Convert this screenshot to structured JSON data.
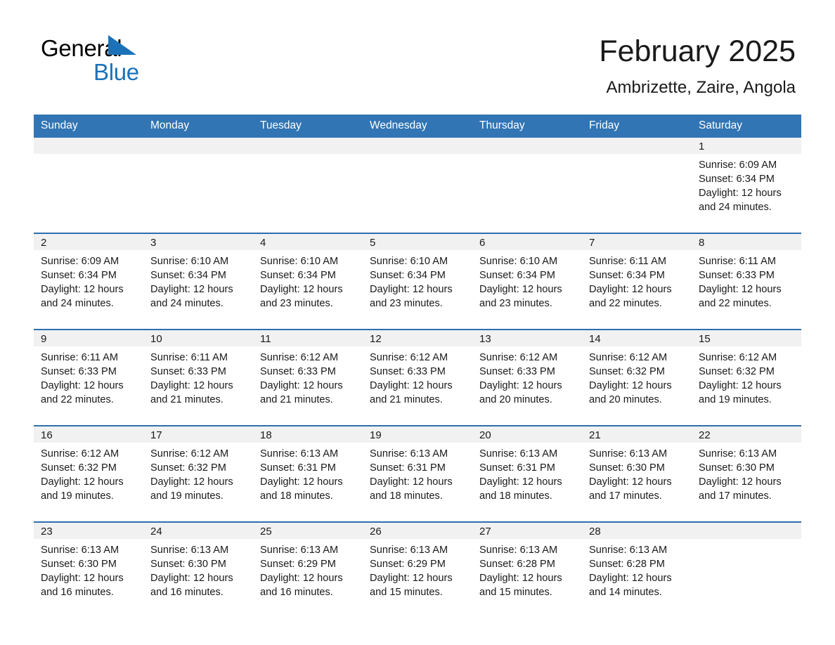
{
  "brand": {
    "word1": "General",
    "word2": "Blue",
    "triangle_color": "#1b72b8",
    "text_color": "#000000"
  },
  "header": {
    "title": "February 2025",
    "subtitle": "Ambrizette, Zaire, Angola"
  },
  "theme": {
    "header_blue": "#3175b4",
    "row_divider_blue": "#2e6fae",
    "daynum_band": "#f1f1f1",
    "page_background": "#ffffff"
  },
  "weekday_headers": [
    "Sunday",
    "Monday",
    "Tuesday",
    "Wednesday",
    "Thursday",
    "Friday",
    "Saturday"
  ],
  "weeks": [
    [
      {
        "day": "",
        "sunrise": "",
        "sunset": "",
        "daylight1": "",
        "daylight2": ""
      },
      {
        "day": "",
        "sunrise": "",
        "sunset": "",
        "daylight1": "",
        "daylight2": ""
      },
      {
        "day": "",
        "sunrise": "",
        "sunset": "",
        "daylight1": "",
        "daylight2": ""
      },
      {
        "day": "",
        "sunrise": "",
        "sunset": "",
        "daylight1": "",
        "daylight2": ""
      },
      {
        "day": "",
        "sunrise": "",
        "sunset": "",
        "daylight1": "",
        "daylight2": ""
      },
      {
        "day": "",
        "sunrise": "",
        "sunset": "",
        "daylight1": "",
        "daylight2": ""
      },
      {
        "day": "1",
        "sunrise": "Sunrise: 6:09 AM",
        "sunset": "Sunset: 6:34 PM",
        "daylight1": "Daylight: 12 hours",
        "daylight2": "and 24 minutes."
      }
    ],
    [
      {
        "day": "2",
        "sunrise": "Sunrise: 6:09 AM",
        "sunset": "Sunset: 6:34 PM",
        "daylight1": "Daylight: 12 hours",
        "daylight2": "and 24 minutes."
      },
      {
        "day": "3",
        "sunrise": "Sunrise: 6:10 AM",
        "sunset": "Sunset: 6:34 PM",
        "daylight1": "Daylight: 12 hours",
        "daylight2": "and 24 minutes."
      },
      {
        "day": "4",
        "sunrise": "Sunrise: 6:10 AM",
        "sunset": "Sunset: 6:34 PM",
        "daylight1": "Daylight: 12 hours",
        "daylight2": "and 23 minutes."
      },
      {
        "day": "5",
        "sunrise": "Sunrise: 6:10 AM",
        "sunset": "Sunset: 6:34 PM",
        "daylight1": "Daylight: 12 hours",
        "daylight2": "and 23 minutes."
      },
      {
        "day": "6",
        "sunrise": "Sunrise: 6:10 AM",
        "sunset": "Sunset: 6:34 PM",
        "daylight1": "Daylight: 12 hours",
        "daylight2": "and 23 minutes."
      },
      {
        "day": "7",
        "sunrise": "Sunrise: 6:11 AM",
        "sunset": "Sunset: 6:34 PM",
        "daylight1": "Daylight: 12 hours",
        "daylight2": "and 22 minutes."
      },
      {
        "day": "8",
        "sunrise": "Sunrise: 6:11 AM",
        "sunset": "Sunset: 6:33 PM",
        "daylight1": "Daylight: 12 hours",
        "daylight2": "and 22 minutes."
      }
    ],
    [
      {
        "day": "9",
        "sunrise": "Sunrise: 6:11 AM",
        "sunset": "Sunset: 6:33 PM",
        "daylight1": "Daylight: 12 hours",
        "daylight2": "and 22 minutes."
      },
      {
        "day": "10",
        "sunrise": "Sunrise: 6:11 AM",
        "sunset": "Sunset: 6:33 PM",
        "daylight1": "Daylight: 12 hours",
        "daylight2": "and 21 minutes."
      },
      {
        "day": "11",
        "sunrise": "Sunrise: 6:12 AM",
        "sunset": "Sunset: 6:33 PM",
        "daylight1": "Daylight: 12 hours",
        "daylight2": "and 21 minutes."
      },
      {
        "day": "12",
        "sunrise": "Sunrise: 6:12 AM",
        "sunset": "Sunset: 6:33 PM",
        "daylight1": "Daylight: 12 hours",
        "daylight2": "and 21 minutes."
      },
      {
        "day": "13",
        "sunrise": "Sunrise: 6:12 AM",
        "sunset": "Sunset: 6:33 PM",
        "daylight1": "Daylight: 12 hours",
        "daylight2": "and 20 minutes."
      },
      {
        "day": "14",
        "sunrise": "Sunrise: 6:12 AM",
        "sunset": "Sunset: 6:32 PM",
        "daylight1": "Daylight: 12 hours",
        "daylight2": "and 20 minutes."
      },
      {
        "day": "15",
        "sunrise": "Sunrise: 6:12 AM",
        "sunset": "Sunset: 6:32 PM",
        "daylight1": "Daylight: 12 hours",
        "daylight2": "and 19 minutes."
      }
    ],
    [
      {
        "day": "16",
        "sunrise": "Sunrise: 6:12 AM",
        "sunset": "Sunset: 6:32 PM",
        "daylight1": "Daylight: 12 hours",
        "daylight2": "and 19 minutes."
      },
      {
        "day": "17",
        "sunrise": "Sunrise: 6:12 AM",
        "sunset": "Sunset: 6:32 PM",
        "daylight1": "Daylight: 12 hours",
        "daylight2": "and 19 minutes."
      },
      {
        "day": "18",
        "sunrise": "Sunrise: 6:13 AM",
        "sunset": "Sunset: 6:31 PM",
        "daylight1": "Daylight: 12 hours",
        "daylight2": "and 18 minutes."
      },
      {
        "day": "19",
        "sunrise": "Sunrise: 6:13 AM",
        "sunset": "Sunset: 6:31 PM",
        "daylight1": "Daylight: 12 hours",
        "daylight2": "and 18 minutes."
      },
      {
        "day": "20",
        "sunrise": "Sunrise: 6:13 AM",
        "sunset": "Sunset: 6:31 PM",
        "daylight1": "Daylight: 12 hours",
        "daylight2": "and 18 minutes."
      },
      {
        "day": "21",
        "sunrise": "Sunrise: 6:13 AM",
        "sunset": "Sunset: 6:30 PM",
        "daylight1": "Daylight: 12 hours",
        "daylight2": "and 17 minutes."
      },
      {
        "day": "22",
        "sunrise": "Sunrise: 6:13 AM",
        "sunset": "Sunset: 6:30 PM",
        "daylight1": "Daylight: 12 hours",
        "daylight2": "and 17 minutes."
      }
    ],
    [
      {
        "day": "23",
        "sunrise": "Sunrise: 6:13 AM",
        "sunset": "Sunset: 6:30 PM",
        "daylight1": "Daylight: 12 hours",
        "daylight2": "and 16 minutes."
      },
      {
        "day": "24",
        "sunrise": "Sunrise: 6:13 AM",
        "sunset": "Sunset: 6:30 PM",
        "daylight1": "Daylight: 12 hours",
        "daylight2": "and 16 minutes."
      },
      {
        "day": "25",
        "sunrise": "Sunrise: 6:13 AM",
        "sunset": "Sunset: 6:29 PM",
        "daylight1": "Daylight: 12 hours",
        "daylight2": "and 16 minutes."
      },
      {
        "day": "26",
        "sunrise": "Sunrise: 6:13 AM",
        "sunset": "Sunset: 6:29 PM",
        "daylight1": "Daylight: 12 hours",
        "daylight2": "and 15 minutes."
      },
      {
        "day": "27",
        "sunrise": "Sunrise: 6:13 AM",
        "sunset": "Sunset: 6:28 PM",
        "daylight1": "Daylight: 12 hours",
        "daylight2": "and 15 minutes."
      },
      {
        "day": "28",
        "sunrise": "Sunrise: 6:13 AM",
        "sunset": "Sunset: 6:28 PM",
        "daylight1": "Daylight: 12 hours",
        "daylight2": "and 14 minutes."
      },
      {
        "day": "",
        "sunrise": "",
        "sunset": "",
        "daylight1": "",
        "daylight2": ""
      }
    ]
  ]
}
